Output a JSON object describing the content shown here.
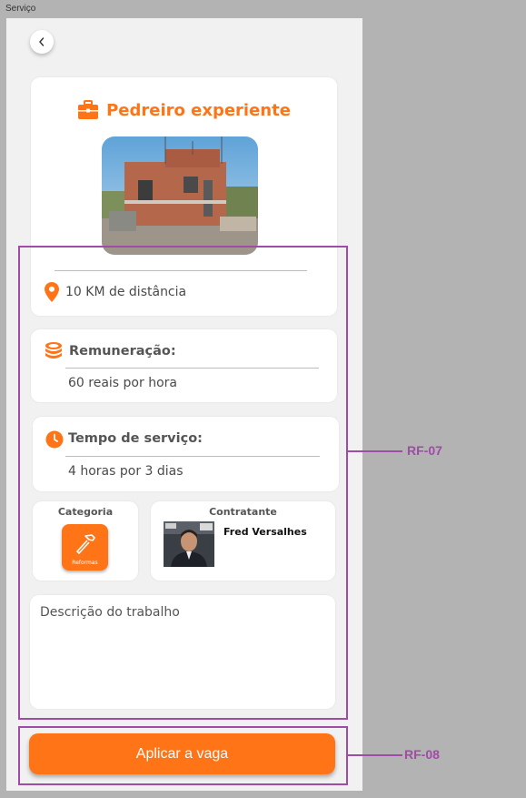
{
  "frame_label": "Serviço",
  "job": {
    "title": "Pedreiro experiente",
    "distance": "10 KM de distância",
    "pay_label": "Remuneração:",
    "pay_value": "60 reais por hora",
    "time_label": "Tempo de serviço:",
    "time_value": "4 horas por 3 dias"
  },
  "category": {
    "heading": "Categoria",
    "name": "Reformas"
  },
  "contractor": {
    "heading": "Contratante",
    "name": "Fred Versalhes"
  },
  "description": {
    "placeholder": "Descrição do trabalho"
  },
  "actions": {
    "apply_label": "Aplicar a vaga"
  },
  "annotations": {
    "rf07": "RF-07",
    "rf08": "RF-08"
  },
  "colors": {
    "accent": "#ff7417",
    "annotation": "#a14ba8"
  },
  "icons": [
    "chevron-left-icon",
    "briefcase-icon",
    "location-pin-icon",
    "coins-icon",
    "clock-icon",
    "hammer-icon"
  ]
}
